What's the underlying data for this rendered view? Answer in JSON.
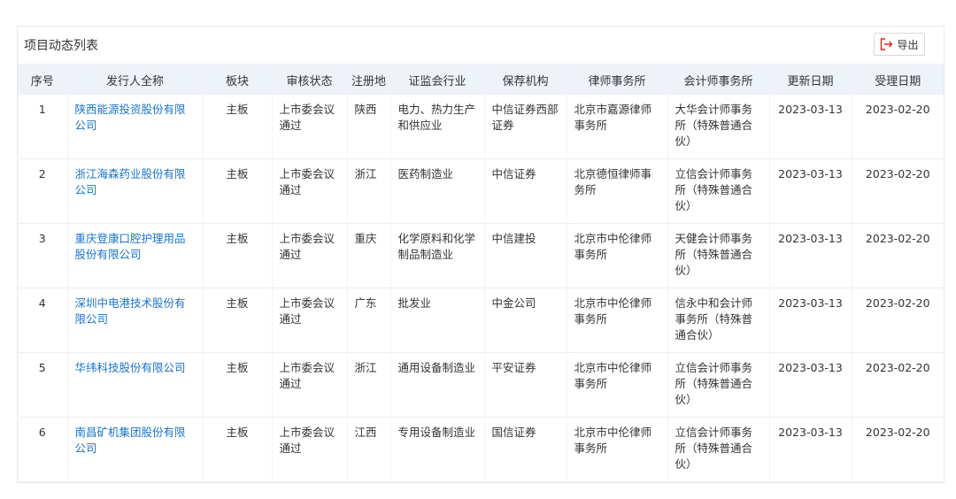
{
  "panel": {
    "title": "项目动态列表",
    "export_label": "导出"
  },
  "table": {
    "headers": [
      "序号",
      "发行人全称",
      "板块",
      "审核状态",
      "注册地",
      "证监会行业",
      "保荐机构",
      "律师事务所",
      "会计师事务所",
      "更新日期",
      "受理日期"
    ],
    "rows": [
      [
        "1",
        "陕西能源投资股份有限公司",
        "主板",
        "上市委会议通过",
        "陕西",
        "电力、热力生产和供应业",
        "中信证券西部证券",
        "北京市嘉源律师事务所",
        "大华会计师事务所（特殊普通合伙）",
        "2023-03-13",
        "2023-02-20"
      ],
      [
        "2",
        "浙江海森药业股份有限公司",
        "主板",
        "上市委会议通过",
        "浙江",
        "医药制造业",
        "中信证券",
        "北京德恒律师事务所",
        "立信会计师事务所（特殊普通合伙）",
        "2023-03-13",
        "2023-02-20"
      ],
      [
        "3",
        "重庆登康口腔护理用品股份有限公司",
        "主板",
        "上市委会议通过",
        "重庆",
        "化学原料和化学制品制造业",
        "中信建投",
        "北京市中伦律师事务所",
        "天健会计师事务所（特殊普通合伙）",
        "2023-03-13",
        "2023-02-20"
      ],
      [
        "4",
        "深圳中电港技术股份有限公司",
        "主板",
        "上市委会议通过",
        "广东",
        "批发业",
        "中金公司",
        "北京市中伦律师事务所",
        "信永中和会计师事务所（特殊普通合伙）",
        "2023-03-13",
        "2023-02-20"
      ],
      [
        "5",
        "华纬科技股份有限公司",
        "主板",
        "上市委会议通过",
        "浙江",
        "通用设备制造业",
        "平安证券",
        "北京市中伦律师事务所",
        "立信会计师事务所（特殊普通合伙）",
        "2023-03-13",
        "2023-02-20"
      ],
      [
        "6",
        "南昌矿机集团股份有限公司",
        "主板",
        "上市委会议通过",
        "江西",
        "专用设备制造业",
        "国信证券",
        "北京市中伦律师事务所",
        "立信会计师事务所（特殊普通合伙）",
        "2023-03-13",
        "2023-02-20"
      ]
    ]
  }
}
